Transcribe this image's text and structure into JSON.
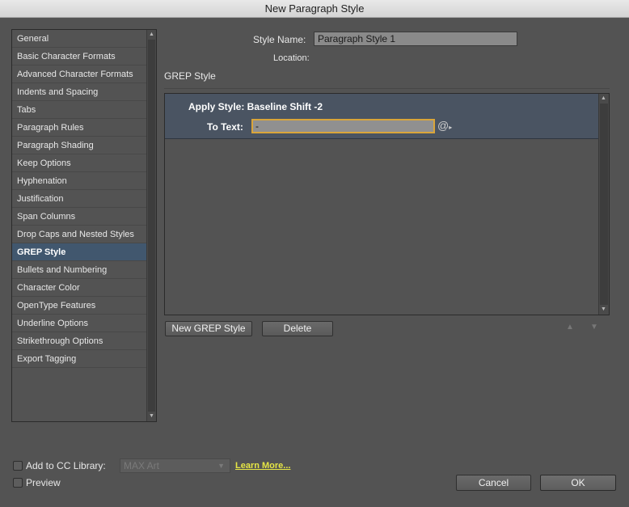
{
  "window": {
    "title": "New Paragraph Style"
  },
  "sidebar": {
    "items": [
      "General",
      "Basic Character Formats",
      "Advanced Character Formats",
      "Indents and Spacing",
      "Tabs",
      "Paragraph Rules",
      "Paragraph Shading",
      "Keep Options",
      "Hyphenation",
      "Justification",
      "Span Columns",
      "Drop Caps and Nested Styles",
      "GREP Style",
      "Bullets and Numbering",
      "Character Color",
      "OpenType Features",
      "Underline Options",
      "Strikethrough Options",
      "Export Tagging"
    ],
    "selected_index": 12
  },
  "style_name": {
    "label": "Style Name:",
    "value": "Paragraph Style 1"
  },
  "location": {
    "label": "Location:"
  },
  "section": {
    "title": "GREP Style"
  },
  "grep": {
    "apply_style": "Apply Style: Baseline Shift -2",
    "to_text_label": "To Text:",
    "to_text_value": "-"
  },
  "buttons": {
    "new_grep": "New GREP Style",
    "delete": "Delete",
    "cancel": "Cancel",
    "ok": "OK"
  },
  "footer": {
    "add_cc_label": "Add to CC Library:",
    "library_value": "MAX Art",
    "learn_more": "Learn More...",
    "preview_label": "Preview"
  },
  "colors": {
    "background": "#535353",
    "selection": "#41576e",
    "focus_ring": "#d9a53a",
    "link": "#e6e645"
  }
}
